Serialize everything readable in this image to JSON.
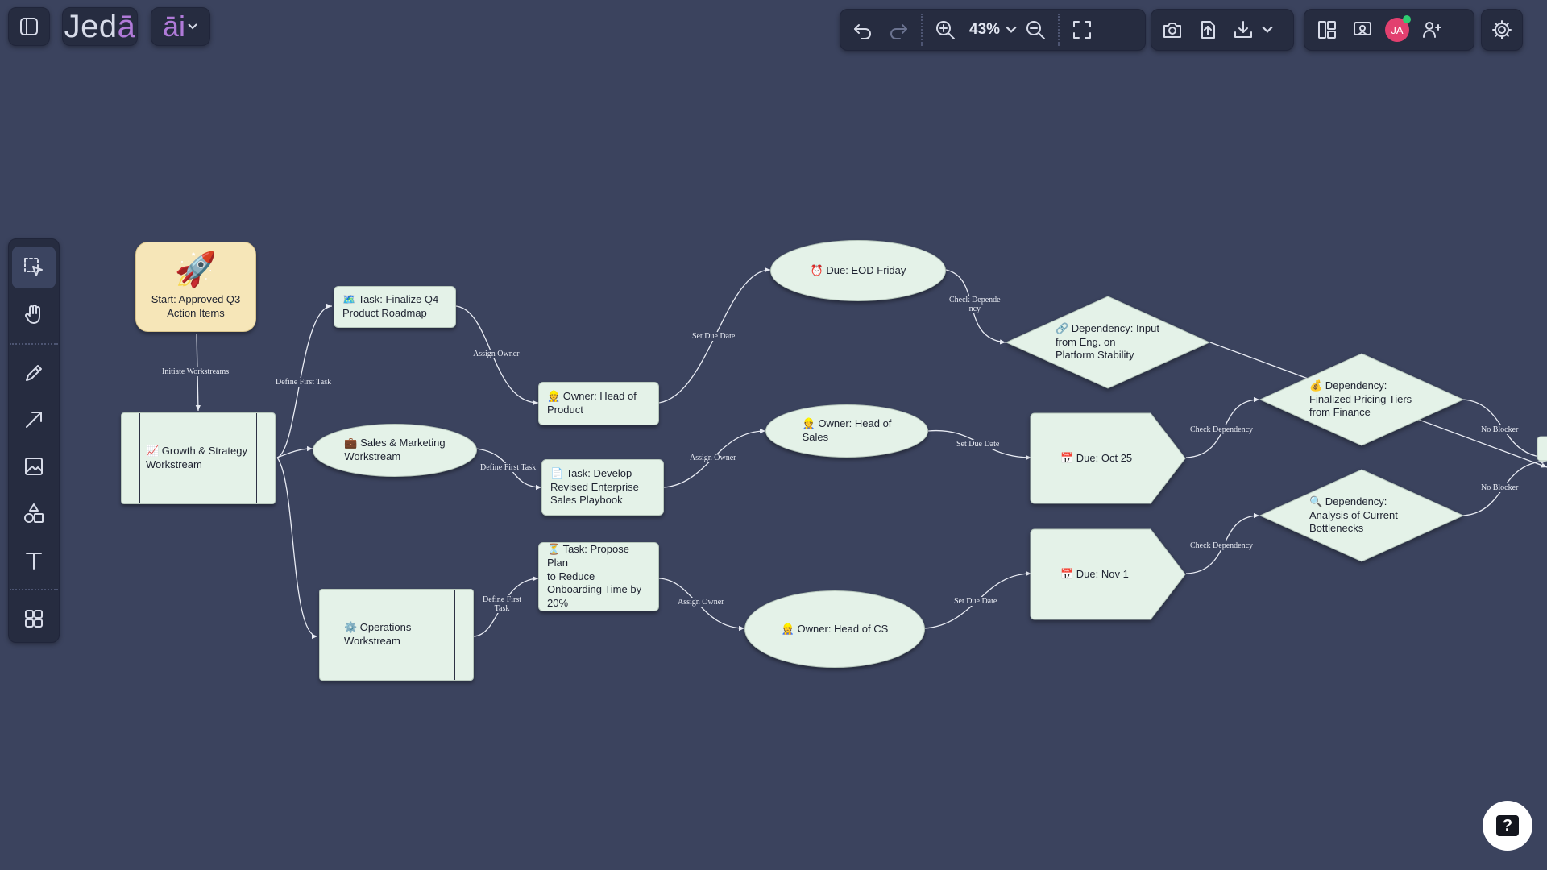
{
  "app": {
    "logo_main": "Jed",
    "logo_accent": "ā",
    "ai_label": "āi"
  },
  "toolbar": {
    "zoom": "43%"
  },
  "user": {
    "initials": "JA"
  },
  "colors": {
    "canvas": "#3b435e",
    "panel": "#262c40",
    "node_fill": "#e4f2e8",
    "start_fill": "#f6e6b8",
    "accent": "#b07ad8",
    "avatar": "#e2406f"
  },
  "nodes": {
    "start": "Start: Approved Q3\nAction Items",
    "start_icon": "🚀",
    "growth": "📈 Growth & Strategy\nWorkstream",
    "sales": "💼 Sales & Marketing\nWorkstream",
    "ops": "⚙️ Operations\nWorkstream",
    "task_roadmap": "🗺️ Task: Finalize Q4\nProduct Roadmap",
    "task_playbook": "📄 Task: Develop\nRevised Enterprise\nSales Playbook",
    "task_onboarding": "⏳ Task: Propose Plan\nto Reduce\nOnboarding Time by\n20%",
    "owner_product": "👷 Owner: Head of\nProduct",
    "owner_sales": "👷 Owner: Head of\nSales",
    "owner_cs": "👷 Owner: Head of CS",
    "due_eod": "⏰ Due: EOD Friday",
    "due_oct": "📅 Due: Oct 25",
    "due_nov": "📅 Due: Nov 1",
    "dep_eng": "🔗 Dependency: Input\nfrom Eng. on\nPlatform Stability",
    "dep_pricing": "💰 Dependency:\nFinalized Pricing Tiers\nfrom Finance",
    "dep_bottlenecks": "🔍 Dependency:\nAnalysis of Current\nBottlenecks"
  },
  "edge_labels": {
    "initiate": "Initiate Workstreams",
    "define_first_task_1": "Define First Task",
    "define_first_task_2": "Define First Task",
    "define_first_task_3": "Define First\nTask",
    "assign_owner_1": "Assign Owner",
    "assign_owner_2": "Assign Owner",
    "assign_owner_3": "Assign Owner",
    "set_due_1": "Set Due Date",
    "set_due_2": "Set Due Date",
    "set_due_3": "Set Due Date",
    "check_dep_1": "Check Depende\nncy",
    "check_dep_2": "Check Dependency",
    "check_dep_3": "Check Dependency",
    "no_blocker_1": "No Blocker",
    "no_blocker_2": "No Blocker"
  }
}
